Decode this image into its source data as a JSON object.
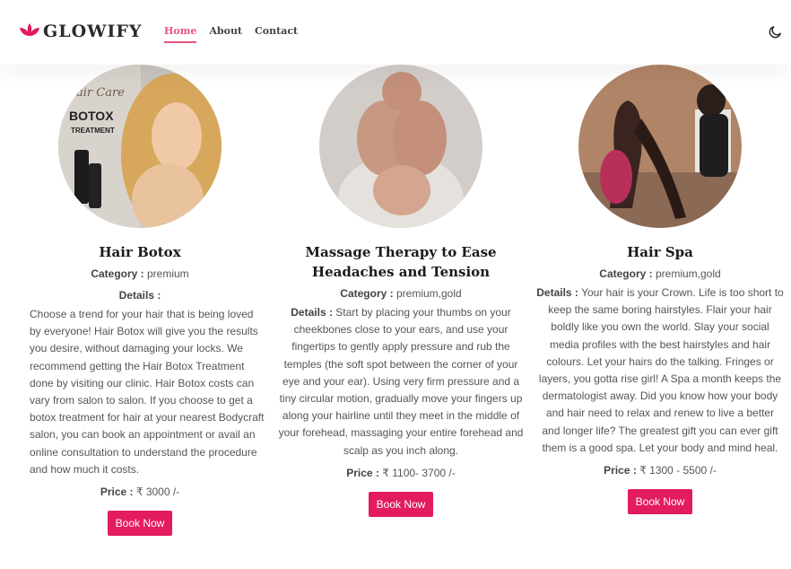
{
  "brand": {
    "name": "GLOWIFY",
    "accent": "#e8557c"
  },
  "nav": {
    "links": [
      {
        "label": "Home",
        "active": true
      },
      {
        "label": "About",
        "active": false
      },
      {
        "label": "Contact",
        "active": false
      }
    ],
    "theme_icon": "moon-icon"
  },
  "colors": {
    "button": "#e31c5f",
    "accent": "#e8557c"
  },
  "services": [
    {
      "image_text": [
        "air Care",
        "BOTOX",
        "TREATMENT"
      ],
      "title": "Hair Botox",
      "category_label": "Category :",
      "category": "premium",
      "details_label": "Details :",
      "details": "Choose a trend for your hair that is being loved by everyone! Hair Botox will give you the results you desire, without damaging your locks. We recommend getting the Hair Botox Treatment done by visiting our clinic. Hair Botox costs can vary from salon to salon. If you choose to get a botox treatment for hair at your nearest Bodycraft salon, you can book an appointment or avail an online consultation to understand the procedure and how much it costs.",
      "price_label": "Price :",
      "price": "₹ 3000 /-",
      "button": "Book Now"
    },
    {
      "title": "Massage Therapy to Ease Headaches and Tension",
      "category_label": "Category :",
      "category": "premium,gold",
      "details_label": "Details :",
      "details": "Start by placing your thumbs on your cheekbones close to your ears, and use your fingertips to gently apply pressure and rub the temples (the soft spot between the corner of your eye and your ear). Using very firm pressure and a tiny circular motion, gradually move your fingers up along your hairline until they meet in the middle of your forehead, massaging your entire forehead and scalp as you inch along.",
      "price_label": "Price :",
      "price": "₹ 1100- 3700 /-",
      "button": "Book Now"
    },
    {
      "title": "Hair Spa",
      "category_label": "Category :",
      "category": "premium,gold",
      "details_label": "Details :",
      "details": "Your hair is your Crown. Life is too short to keep the same boring hairstyles. Flair your hair boldly like you own the world. Slay your social media profiles with the best hairstyles and hair colours. Let your hairs do the talking. Fringes or layers, you gotta rise girl! A Spa a month keeps the dermatologist away. Did you know how your body and hair need to relax and renew to live a better and longer life? The greatest gift you can ever gift them is a good spa. Let your body and mind heal.",
      "price_label": "Price :",
      "price": "₹ 1300 - 5500 /-",
      "button": "Book Now"
    }
  ]
}
